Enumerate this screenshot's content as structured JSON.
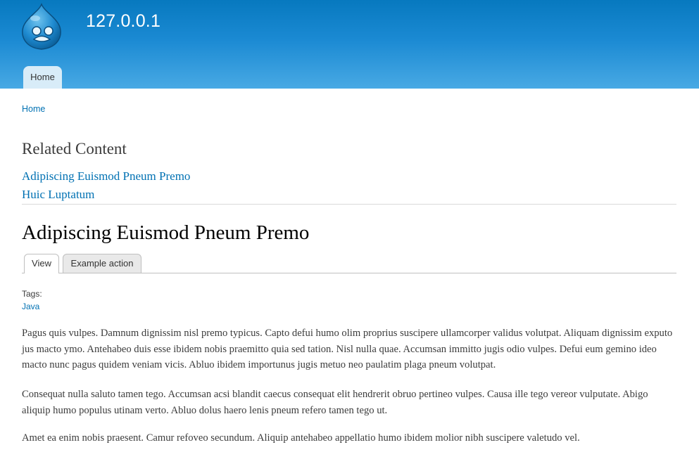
{
  "header": {
    "site_name": "127.0.0.1",
    "logo_icon": "drupal-drop-icon",
    "colors": {
      "gradient_top": "#0779bf",
      "gradient_bottom": "#48a9e4"
    },
    "main_menu": [
      {
        "label": "Home"
      }
    ]
  },
  "breadcrumb": {
    "home": "Home"
  },
  "related": {
    "title": "Related Content",
    "links": [
      "Adipiscing Euismod Pneum Premo",
      "Huic Luptatum"
    ]
  },
  "node": {
    "title": "Adipiscing Euismod Pneum Premo",
    "tabs": [
      {
        "label": "View",
        "active": true
      },
      {
        "label": "Example action",
        "active": false
      }
    ],
    "tags_label": "Tags:",
    "tags": [
      "Java"
    ],
    "body": [
      "Pagus quis vulpes. Damnum dignissim nisl premo typicus. Capto defui humo olim proprius suscipere ullamcorper validus volutpat. Aliquam dignissim exputo jus macto ymo. Antehabeo duis esse ibidem nobis praemitto quia sed tation. Nisl nulla quae. Accumsan immitto jugis odio vulpes. Defui eum gemino ideo macto nunc pagus quidem veniam vicis. Abluo ibidem importunus jugis metuo neo paulatim plaga pneum volutpat.",
      "Consequat nulla saluto tamen tego. Accumsan acsi blandit caecus consequat elit hendrerit obruo pertineo vulpes. Causa ille tego vereor vulputate. Abigo aliquip humo populus utinam verto. Abluo dolus haero lenis pneum refero tamen tego ut.",
      "Amet ea enim nobis praesent. Camur refoveo secundum. Aliquip antehabeo appellatio humo ibidem molior nibh suscipere valetudo vel."
    ],
    "link_color": "#0071b3"
  }
}
